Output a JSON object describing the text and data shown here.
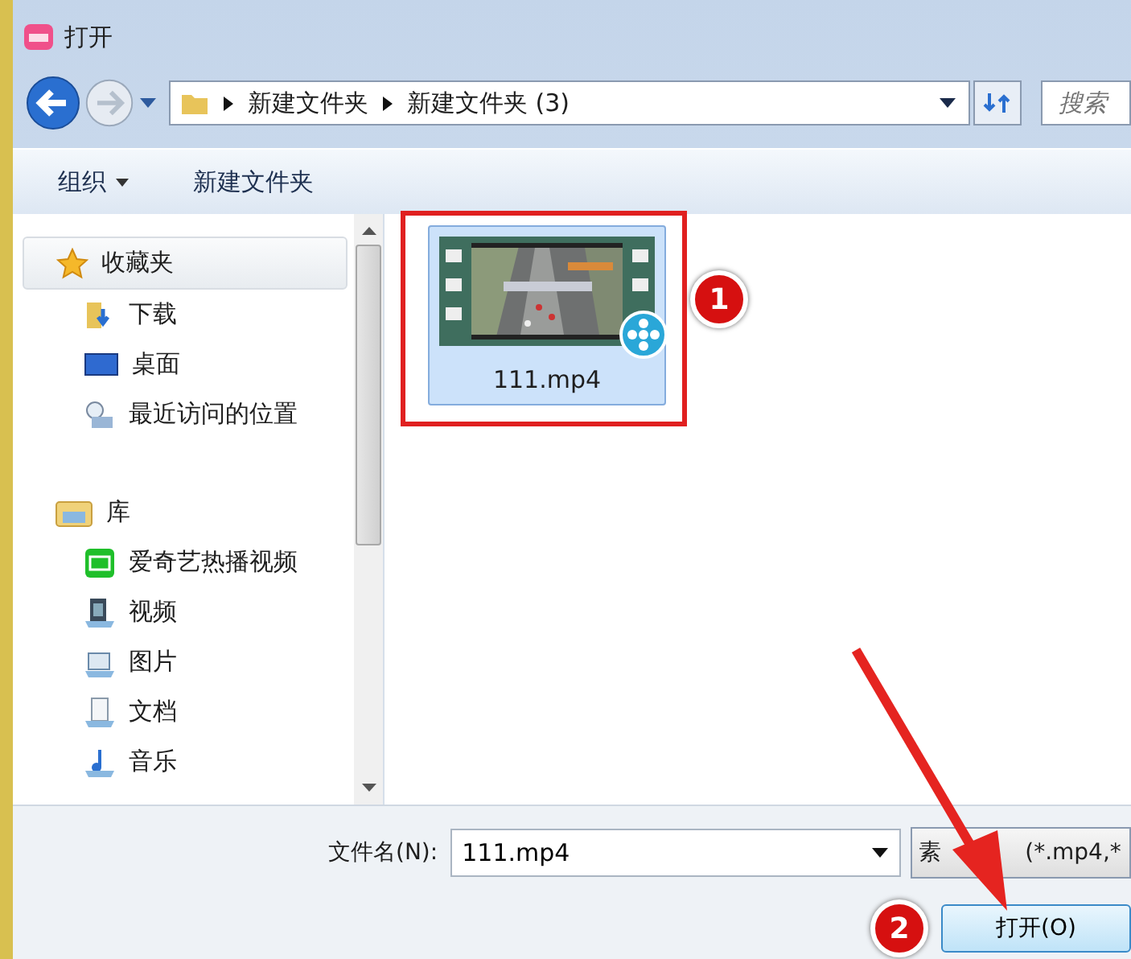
{
  "window": {
    "title": "打开"
  },
  "address_bar": {
    "path": [
      "新建文件夹",
      "新建文件夹 (3)"
    ]
  },
  "search": {
    "placeholder": "搜索"
  },
  "toolbar": {
    "items": [
      {
        "label": "组织",
        "dropdown": true
      },
      {
        "label": "新建文件夹",
        "dropdown": false
      }
    ]
  },
  "sidebar": {
    "groups": [
      {
        "label": "收藏夹",
        "kind": "star",
        "selected": true,
        "children": [
          {
            "label": "下载",
            "kind": "download",
            "selected": false
          },
          {
            "label": "桌面",
            "kind": "desktop",
            "selected": false
          },
          {
            "label": "最近访问的位置",
            "kind": "recent",
            "selected": false
          }
        ]
      },
      {
        "label": "库",
        "kind": "library",
        "selected": false,
        "children": [
          {
            "label": "爱奇艺热播视频",
            "kind": "app",
            "selected": false
          },
          {
            "label": "视频",
            "kind": "video",
            "selected": false
          },
          {
            "label": "图片",
            "selected": false
          },
          {
            "label": "文档",
            "kind": "document",
            "selected": false
          },
          {
            "label": "音乐",
            "kind": "music",
            "selected": false
          }
        ]
      }
    ]
  },
  "files": [
    {
      "name": "111.mp4",
      "selected": true
    }
  ],
  "annotations": [
    {
      "label": "1"
    },
    {
      "label": "2"
    }
  ],
  "filename": {
    "label": "文件名(N):",
    "value": "111.mp4"
  },
  "filter": {
    "parts": [
      "素",
      "(*.mp4,*"
    ]
  },
  "buttons": [
    {
      "label": "打开(O)"
    }
  ]
}
